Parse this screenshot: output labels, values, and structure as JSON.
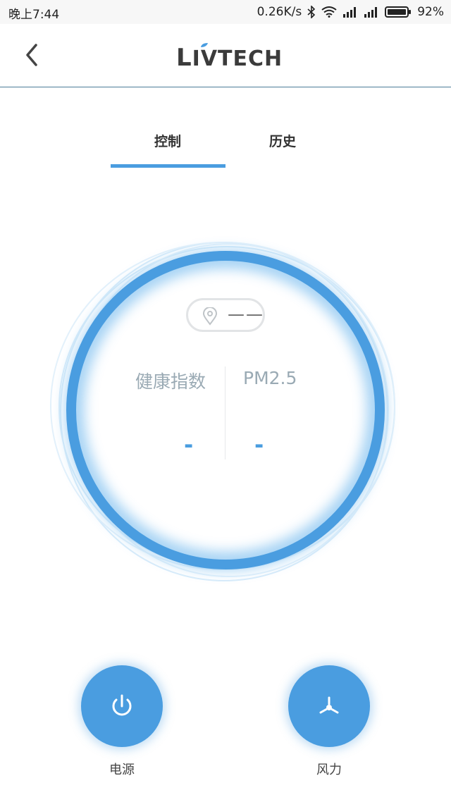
{
  "status_bar": {
    "time": "晚上7:44",
    "net_speed": "0.26K/s",
    "battery": "92%",
    "icons": [
      "bluetooth-icon",
      "wifi-icon",
      "signal-icon",
      "signal-icon",
      "battery-icon"
    ]
  },
  "header": {
    "back_icon": "chevron-left-icon",
    "logo_text_first": "L",
    "logo_text_rest": "IVTECH"
  },
  "tabs": [
    {
      "label": "控制",
      "active": true
    },
    {
      "label": "历史",
      "active": false
    }
  ],
  "location": {
    "icon": "location-pin-icon",
    "text": "——"
  },
  "metrics": {
    "health_label": "健康指数",
    "health_value": "-",
    "pm_label": "PM2.5",
    "pm_value": "-"
  },
  "controls": {
    "power_label": "电源",
    "power_icon": "power-icon",
    "fan_label": "风力",
    "fan_icon": "fan-icon"
  },
  "colors": {
    "accent": "#4a9de0",
    "ring_glow": "#bfe0f7",
    "label_gray": "#9aaab4"
  }
}
